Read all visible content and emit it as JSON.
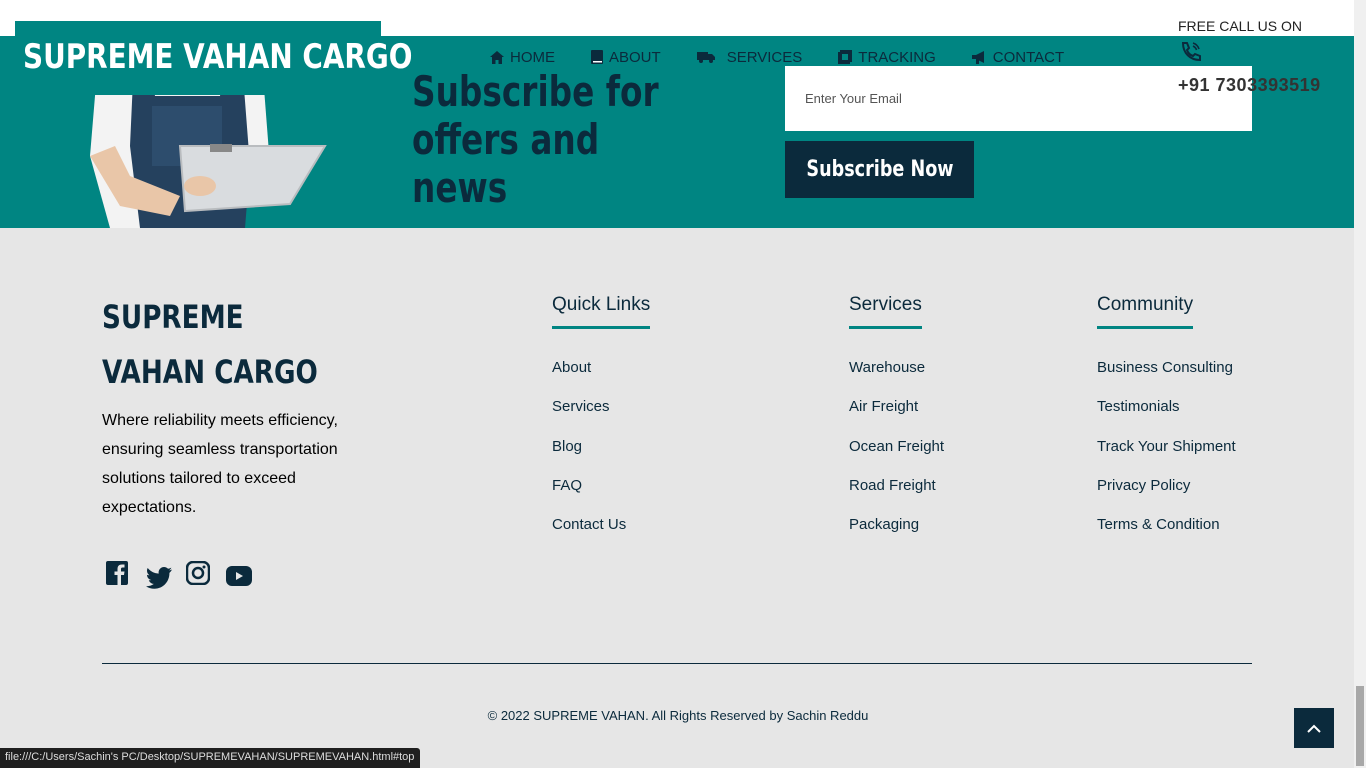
{
  "brand": {
    "name": "SUPREME VAHAN CARGO"
  },
  "nav": {
    "items": [
      {
        "label": "HOME",
        "icon": "home-icon"
      },
      {
        "label": "ABOUT",
        "icon": "book-icon"
      },
      {
        "label": "SERVICES",
        "icon": "truck-icon"
      },
      {
        "label": "TRACKING",
        "icon": "tracking-icon"
      },
      {
        "label": "CONTACT",
        "icon": "megaphone-icon"
      }
    ]
  },
  "call": {
    "title": "FREE CALL US ON",
    "icon": "phone-icon",
    "number": "+91 7303393519"
  },
  "subscribe": {
    "title": "Subscribe for offers and news",
    "email_placeholder": "Enter Your Email",
    "button_label": "Subscribe Now"
  },
  "footer": {
    "brand": "SUPREME VAHAN CARGO",
    "description": "Where reliability meets efficiency, ensuring seamless transportation solutions tailored to exceed expectations.",
    "socials": [
      "facebook-icon",
      "twitter-icon",
      "instagram-icon",
      "youtube-icon"
    ],
    "quick_links": {
      "title": "Quick Links",
      "items": [
        "About",
        "Services",
        "Blog",
        "FAQ",
        "Contact Us"
      ]
    },
    "services": {
      "title": "Services",
      "items": [
        "Warehouse",
        "Air Freight",
        "Ocean Freight",
        "Road Freight",
        "Packaging"
      ]
    },
    "community": {
      "title": "Community",
      "items": [
        "Business Consulting",
        "Testimonials",
        "Track Your Shipment",
        "Privacy Policy",
        "Terms & Condition"
      ]
    },
    "copyright": "© 2022 SUPREME VAHAN. All Rights Reserved by Sachin Reddu"
  },
  "status_bar": {
    "url": "file:///C:/Users/Sachin's PC/Desktop/SUPREMEVAHAN/SUPREMEVAHAN.html#top"
  },
  "colors": {
    "teal": "#008582",
    "navy": "#0b2a3c",
    "footer_bg": "#e6e6e6"
  }
}
